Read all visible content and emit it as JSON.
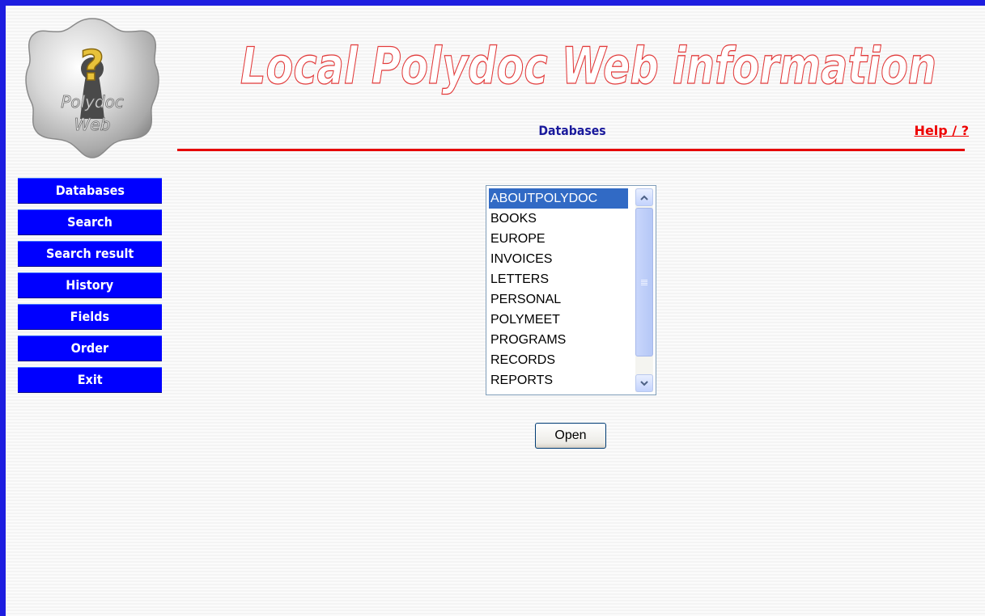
{
  "header": {
    "title": "Local Polydoc Web information",
    "page_heading": "Databases",
    "help_link": "Help / ?"
  },
  "logo": {
    "line1": "Polydoc",
    "line2": "Web",
    "glyph": "?"
  },
  "nav": {
    "items": [
      {
        "label": "Databases"
      },
      {
        "label": "Search"
      },
      {
        "label": "Search result"
      },
      {
        "label": "History"
      },
      {
        "label": "Fields"
      },
      {
        "label": "Order"
      },
      {
        "label": "Exit"
      }
    ]
  },
  "databases": {
    "items": [
      "ABOUTPOLYDOC",
      "BOOKS",
      "EUROPE",
      "INVOICES",
      "LETTERS",
      "PERSONAL",
      "POLYMEET",
      "PROGRAMS",
      "RECORDS",
      "REPORTS"
    ],
    "selected": "ABOUTPOLYDOC"
  },
  "actions": {
    "open_label": "Open"
  },
  "colors": {
    "frame_border": "#1d1de0",
    "nav_button": "#0000ff",
    "title_outline": "#e23b3b",
    "heading": "#1a1a9c",
    "help": "#ee0000",
    "rule": "#e60000",
    "selection": "#316ac5"
  }
}
